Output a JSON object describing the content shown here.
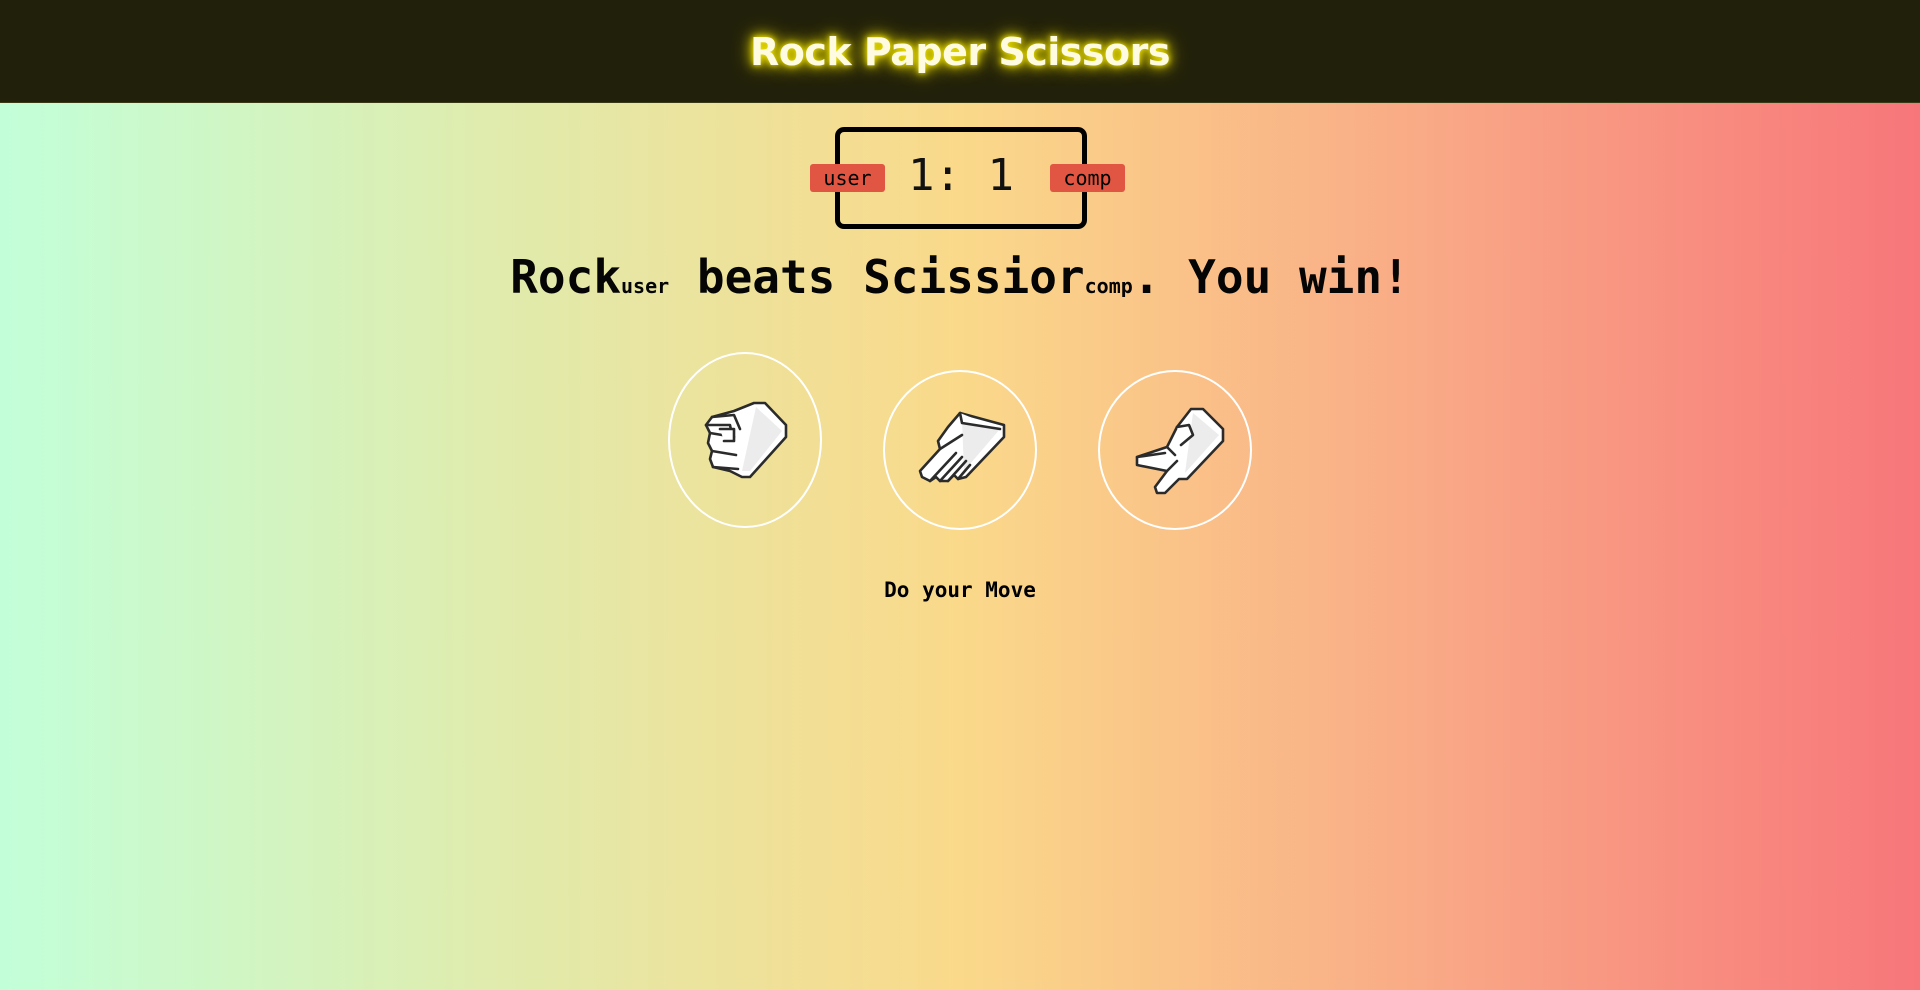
{
  "header": {
    "title": "Rock Paper Scissors"
  },
  "scoreboard": {
    "score": "1: 1",
    "user_label": "user",
    "comp_label": "comp"
  },
  "result": {
    "user_choice": "Rock",
    "user_tag": "user",
    "verb": " beats ",
    "comp_choice": "Scissior",
    "comp_tag": "comp",
    "outcome": ". You win!"
  },
  "choices": [
    {
      "name": "rock",
      "icon": "rock-hand-icon"
    },
    {
      "name": "paper",
      "icon": "paper-hand-icon"
    },
    {
      "name": "scissors",
      "icon": "scissors-hand-icon"
    }
  ],
  "message": "Do your Move",
  "colors": {
    "header_bg": "#21200a",
    "title_glow": "#f3e600",
    "badge": "#e05642",
    "gradient": [
      "#c2ffd9",
      "#dfecae",
      "#fad98a",
      "#f9a886",
      "#f7767a"
    ]
  }
}
